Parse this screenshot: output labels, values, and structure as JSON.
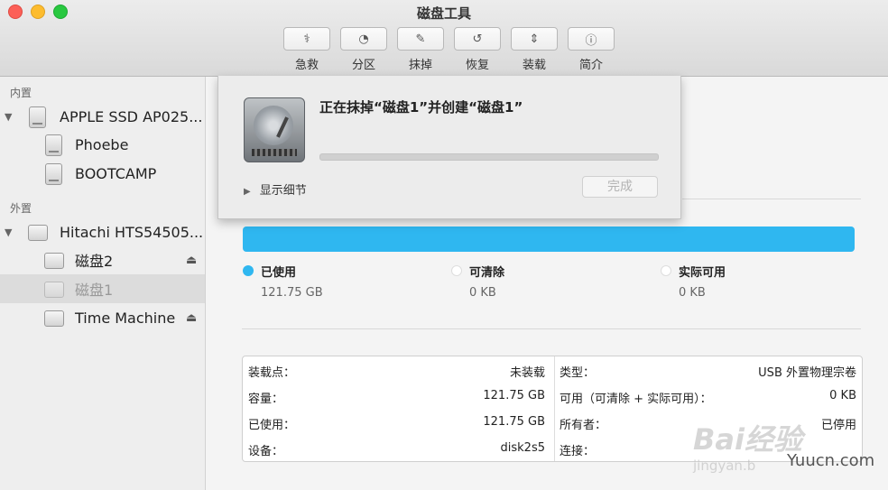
{
  "window": {
    "title": "磁盘工具"
  },
  "toolbar": {
    "items": [
      {
        "label": "急救",
        "icon": "first-aid-icon"
      },
      {
        "label": "分区",
        "icon": "partition-icon"
      },
      {
        "label": "抹掉",
        "icon": "erase-icon"
      },
      {
        "label": "恢复",
        "icon": "restore-icon"
      },
      {
        "label": "装载",
        "icon": "mount-icon"
      },
      {
        "label": "简介",
        "icon": "info-icon"
      }
    ]
  },
  "sidebar": {
    "internal_label": "内置",
    "external_label": "外置",
    "internal": {
      "disk": "APPLE SSD AP025...",
      "volumes": [
        "Phoebe",
        "BOOTCAMP"
      ]
    },
    "external": {
      "disk": "Hitachi HTS54505...",
      "volumes": [
        "磁盘2",
        "磁盘1",
        "Time Machine"
      ],
      "selected": "磁盘1"
    }
  },
  "sheet": {
    "title": "正在抹掉“磁盘1”并创建“磁盘1”",
    "progress": 0,
    "details_label": "显示细节",
    "done_label": "完成"
  },
  "usage": {
    "bar_color": "#2fb7f0",
    "legend": [
      {
        "name": "已使用",
        "value": "121.75 GB",
        "color": "#2fb7f0"
      },
      {
        "name": "可清除",
        "value": "0 KB",
        "color": "#ffffff"
      },
      {
        "name": "实际可用",
        "value": "0 KB",
        "color": "#ffffff"
      }
    ]
  },
  "info": {
    "left": [
      {
        "label": "装载点：",
        "value": "未装载"
      },
      {
        "label": "容量：",
        "value": "121.75 GB"
      },
      {
        "label": "已使用：",
        "value": "121.75 GB"
      },
      {
        "label": "设备：",
        "value": "disk2s5"
      }
    ],
    "right": [
      {
        "label": "类型：",
        "value": "USB 外置物理宗卷"
      },
      {
        "label": "可用（可清除 + 实际可用）：",
        "value": "0 KB"
      },
      {
        "label": "所有者：",
        "value": "已停用"
      },
      {
        "label": "连接：",
        "value": ""
      }
    ]
  },
  "watermark": {
    "line1": "Bai经验",
    "line2": "jingyan.b",
    "line3": "Yuucn.com"
  }
}
